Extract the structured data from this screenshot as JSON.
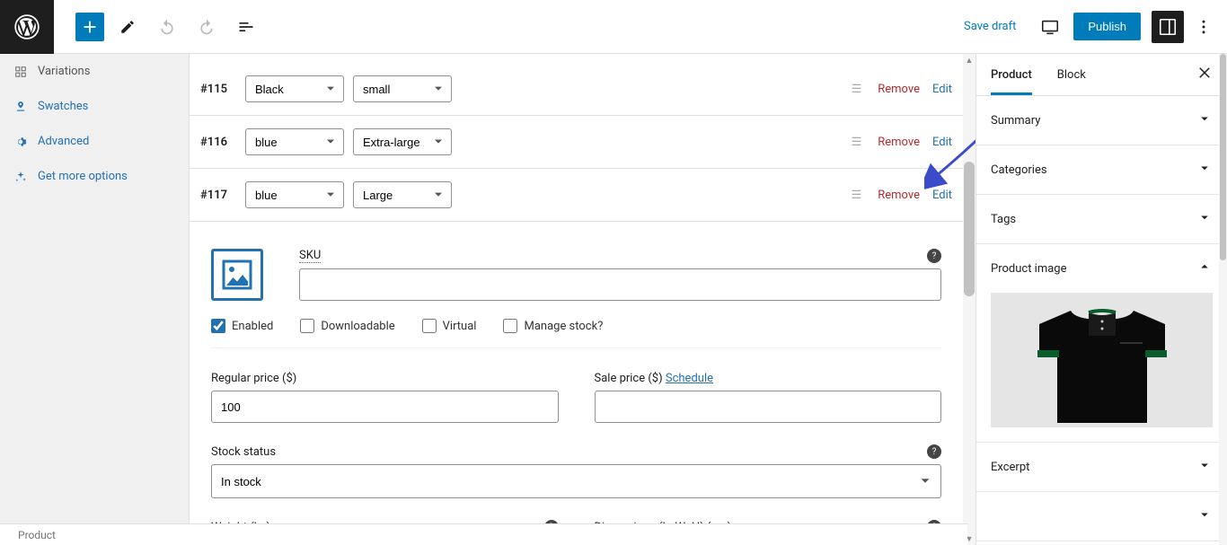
{
  "toolbar": {
    "save_draft": "Save draft",
    "publish": "Publish"
  },
  "left_menu": {
    "items": [
      {
        "icon": "grid",
        "label": "Variations",
        "muted": true
      },
      {
        "icon": "swatch",
        "label": "Swatches"
      },
      {
        "icon": "gear",
        "label": "Advanced"
      },
      {
        "icon": "plus",
        "label": "Get more options"
      }
    ]
  },
  "variations": [
    {
      "id": "#115",
      "color": "Black",
      "size": "small"
    },
    {
      "id": "#116",
      "color": "blue",
      "size": "Extra-large"
    },
    {
      "id": "#117",
      "color": "blue",
      "size": "Large"
    }
  ],
  "var_actions": {
    "remove": "Remove",
    "edit": "Edit"
  },
  "panel": {
    "sku_label": "SKU",
    "sku_value": "",
    "enabled_label": "Enabled",
    "downloadable_label": "Downloadable",
    "virtual_label": "Virtual",
    "manage_stock_label": "Manage stock?",
    "enabled": true,
    "downloadable": false,
    "virtual": false,
    "manage_stock": false,
    "regular_price_label": "Regular price ($)",
    "regular_price": "100",
    "sale_price_label": "Sale price ($)",
    "schedule_label": "Schedule",
    "sale_price": "",
    "stock_status_label": "Stock status",
    "stock_status": "In stock",
    "weight_label": "Weight (kg)",
    "dimensions_label": "Dimensions (L×W×H) (cm)"
  },
  "right_panel": {
    "tabs": {
      "product": "Product",
      "block": "Block"
    },
    "sections": {
      "summary": "Summary",
      "categories": "Categories",
      "tags": "Tags",
      "product_image": "Product image",
      "excerpt": "Excerpt"
    }
  },
  "footer": {
    "breadcrumb": "Product"
  }
}
